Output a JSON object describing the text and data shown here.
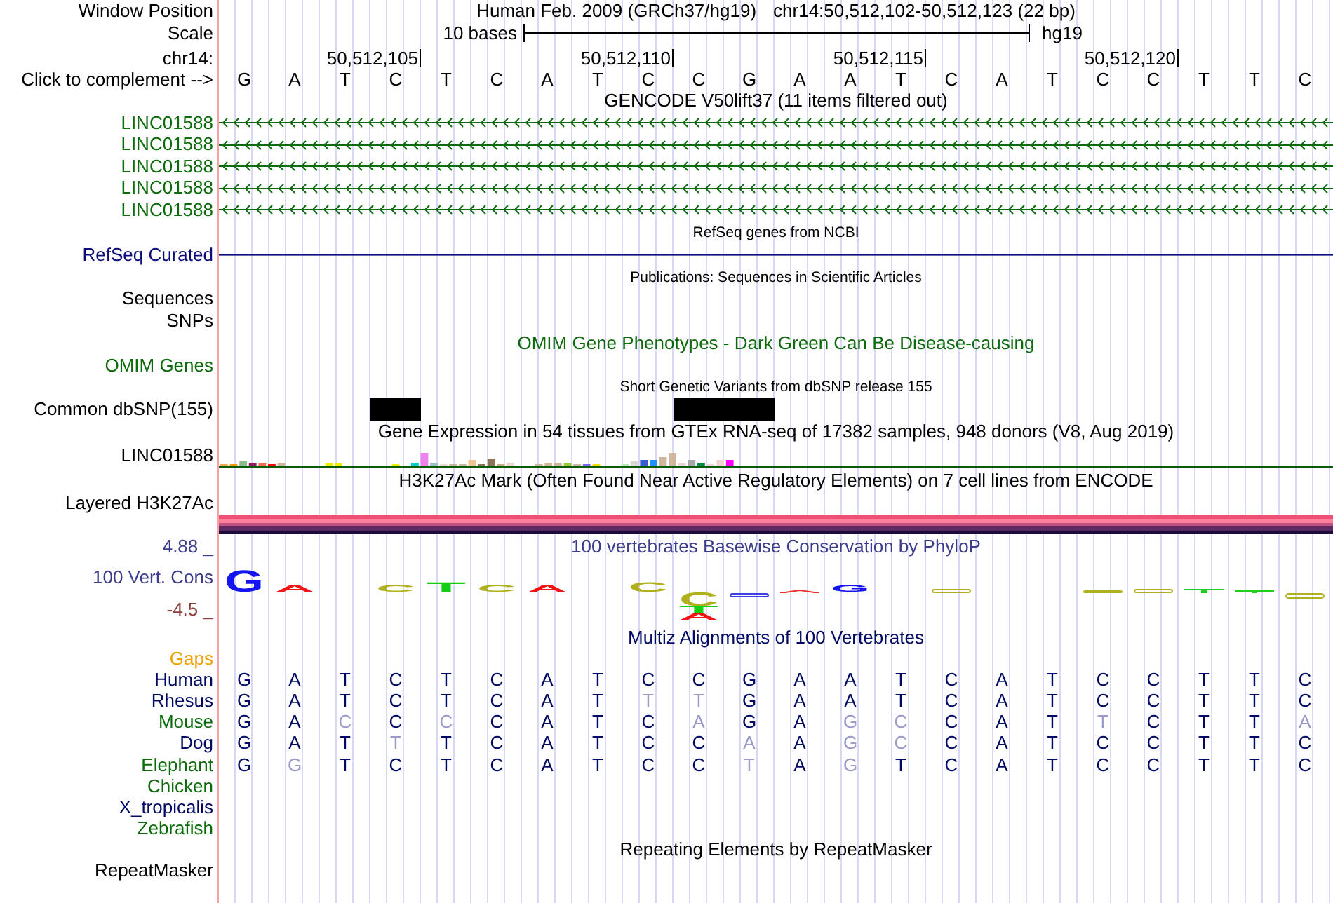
{
  "header": {
    "position": {
      "label": "Window Position",
      "assembly": "Human Feb. 2009 (GRCh37/hg19)",
      "range": "chr14:50,512,102-50,512,123 (22 bp)"
    },
    "scale": {
      "label": "Scale",
      "span": "10 bases",
      "genome": "hg19"
    },
    "ruler": {
      "label": "chr14:",
      "ticks": [
        "50,512,105",
        "50,512,110",
        "50,512,115",
        "50,512,120"
      ]
    },
    "sequence": {
      "label": "Click to complement -->",
      "bases": [
        "G",
        "A",
        "T",
        "C",
        "T",
        "C",
        "A",
        "T",
        "C",
        "C",
        "G",
        "A",
        "A",
        "T",
        "C",
        "A",
        "T",
        "C",
        "C",
        "T",
        "T",
        "C"
      ]
    }
  },
  "tracks": [
    {
      "kind": "genes",
      "title": "GENCODE V50lift37 (11 items filtered out)",
      "color": "#000000",
      "rows": [
        {
          "label": "LINC01588",
          "color": "#0c6c0c"
        },
        {
          "label": "LINC01588",
          "color": "#0c6c0c"
        },
        {
          "label": "LINC01588",
          "color": "#0c6c0c"
        },
        {
          "label": "LINC01588",
          "color": "#0c6c0c"
        },
        {
          "label": "LINC01588",
          "color": "#0c6c0c"
        }
      ]
    },
    {
      "kind": "refseq",
      "title": "RefSeq genes from NCBI",
      "color": "#000000",
      "rows": [
        {
          "label": "RefSeq Curated",
          "color": "#0c0c78"
        }
      ]
    },
    {
      "kind": "publications",
      "title": "Publications: Sequences in Scientific Articles",
      "color": "#000000",
      "rows": [
        {
          "label": "Sequences",
          "color": "#000000"
        },
        {
          "label": "SNPs",
          "color": "#000000"
        }
      ]
    },
    {
      "kind": "omim",
      "title": "OMIM Gene Phenotypes - Dark Green Can Be Disease-causing",
      "color": "#0c6c0c",
      "rows": [
        {
          "label": "OMIM Genes",
          "color": "#0c6c0c"
        }
      ]
    },
    {
      "kind": "dbsnp",
      "title": "Short Genetic Variants from dbSNP release 155",
      "color": "#000000",
      "rows": [
        {
          "label": "Common dbSNP(155)",
          "color": "#000000"
        }
      ]
    },
    {
      "kind": "gtex",
      "title": "Gene Expression in 54 tissues from GTEx RNA-seq of 17382 samples, 948 donors (V8, Aug 2019)",
      "color": "#000000",
      "rows": [
        {
          "label": "LINC01588",
          "color": "#000000"
        }
      ]
    },
    {
      "kind": "h3k27ac",
      "title": "H3K27Ac Mark (Often Found Near Active Regulatory Elements) on 7 cell lines from ENCODE",
      "color": "#000000",
      "rows": [
        {
          "label": "Layered H3K27Ac",
          "color": "#000000"
        }
      ]
    },
    {
      "kind": "phylop",
      "title": "100 vertebrates Basewise Conservation by PhyloP",
      "color": "#3c3c8c",
      "axis": [
        {
          "text": "4.88 _",
          "color": "#3c3c8c"
        },
        {
          "text": "-4.5 _",
          "color": "#8c3c3c"
        }
      ],
      "rows": [
        {
          "label": "100 Vert. Cons",
          "color": "#3c3c8c"
        }
      ],
      "logo": [
        {
          "above": [
            {
              "letter": "G",
              "color": "#1414f0"
            }
          ]
        },
        {
          "above": [
            {
              "letter": "A",
              "color": "#f01414"
            }
          ]
        },
        {
          "above": [
            {
              "letter": "C",
              "color": "#b0b01e"
            }
          ]
        },
        {
          "above": [
            {
              "letter": "T",
              "color": "#14d014"
            }
          ]
        },
        {
          "above": [
            {
              "letter": "C",
              "color": "#b0b01e"
            }
          ]
        },
        {
          "above": [
            {
              "letter": "A",
              "color": "#f01414"
            }
          ]
        },
        {
          "above": [
            {
              "letter": "C",
              "color": "#b0b01e"
            }
          ]
        },
        {
          "below": [
            {
              "letter": "C",
              "color": "#b0b01e"
            },
            {
              "letter": "T",
              "color": "#14d014"
            },
            {
              "letter": "A",
              "color": "#f01414"
            }
          ]
        },
        {
          "above": [
            {
              "letter": "G",
              "color": "#1414f0"
            }
          ]
        }
      ]
    },
    {
      "kind": "multiz",
      "title": "Multiz Alignments of 100 Vertebrates",
      "color": "#000a64",
      "rows": [
        {
          "label": "Gaps",
          "color": "#f0a000"
        },
        {
          "label": "Human",
          "color": "#000a64",
          "bases": [
            {
              "base": "G",
              "differs": false
            },
            {
              "base": "A",
              "differs": false
            },
            {
              "base": "T",
              "differs": false
            },
            {
              "base": "C",
              "differs": false
            },
            {
              "base": "T",
              "differs": false
            },
            {
              "base": "C",
              "differs": false
            },
            {
              "base": "A",
              "differs": false
            },
            {
              "base": "T",
              "differs": false
            },
            {
              "base": "C",
              "differs": false
            },
            {
              "base": "C",
              "differs": false
            },
            {
              "base": "G",
              "differs": false
            },
            {
              "base": "A",
              "differs": false
            },
            {
              "base": "A",
              "differs": false
            },
            {
              "base": "T",
              "differs": false
            },
            {
              "base": "C",
              "differs": false
            },
            {
              "base": "A",
              "differs": false
            },
            {
              "base": "T",
              "differs": false
            },
            {
              "base": "C",
              "differs": false
            },
            {
              "base": "C",
              "differs": false
            },
            {
              "base": "T",
              "differs": false
            },
            {
              "base": "T",
              "differs": false
            },
            {
              "base": "C",
              "differs": false
            }
          ]
        },
        {
          "label": "Rhesus",
          "color": "#000a64",
          "bases": [
            {
              "base": "G",
              "differs": false
            },
            {
              "base": "A",
              "differs": false
            },
            {
              "base": "T",
              "differs": false
            },
            {
              "base": "C",
              "differs": false
            },
            {
              "base": "T",
              "differs": false
            },
            {
              "base": "C",
              "differs": false
            },
            {
              "base": "A",
              "differs": false
            },
            {
              "base": "T",
              "differs": false
            },
            {
              "base": "T",
              "differs": true
            },
            {
              "base": "T",
              "differs": true
            },
            {
              "base": "G",
              "differs": false
            },
            {
              "base": "A",
              "differs": false
            },
            {
              "base": "A",
              "differs": false
            },
            {
              "base": "T",
              "differs": false
            },
            {
              "base": "C",
              "differs": false
            },
            {
              "base": "A",
              "differs": false
            },
            {
              "base": "T",
              "differs": false
            },
            {
              "base": "C",
              "differs": false
            },
            {
              "base": "C",
              "differs": false
            },
            {
              "base": "T",
              "differs": false
            },
            {
              "base": "T",
              "differs": false
            },
            {
              "base": "C",
              "differs": false
            }
          ]
        },
        {
          "label": "Mouse",
          "color": "#0c6c0c",
          "bases": [
            {
              "base": "G",
              "differs": false
            },
            {
              "base": "A",
              "differs": false
            },
            {
              "base": "C",
              "differs": true
            },
            {
              "base": "C",
              "differs": false
            },
            {
              "base": "C",
              "differs": true
            },
            {
              "base": "C",
              "differs": false
            },
            {
              "base": "A",
              "differs": false
            },
            {
              "base": "T",
              "differs": false
            },
            {
              "base": "C",
              "differs": false
            },
            {
              "base": "A",
              "differs": true
            },
            {
              "base": "G",
              "differs": false
            },
            {
              "base": "A",
              "differs": false
            },
            {
              "base": "G",
              "differs": true
            },
            {
              "base": "C",
              "differs": true
            },
            {
              "base": "C",
              "differs": false
            },
            {
              "base": "A",
              "differs": false
            },
            {
              "base": "T",
              "differs": false
            },
            {
              "base": "T",
              "differs": true
            },
            {
              "base": "C",
              "differs": false
            },
            {
              "base": "T",
              "differs": false
            },
            {
              "base": "T",
              "differs": false
            },
            {
              "base": "A",
              "differs": true
            }
          ]
        },
        {
          "label": "Dog",
          "color": "#000a64",
          "bases": [
            {
              "base": "G",
              "differs": false
            },
            {
              "base": "A",
              "differs": false
            },
            {
              "base": "T",
              "differs": false
            },
            {
              "base": "T",
              "differs": true
            },
            {
              "base": "T",
              "differs": false
            },
            {
              "base": "C",
              "differs": false
            },
            {
              "base": "A",
              "differs": false
            },
            {
              "base": "T",
              "differs": false
            },
            {
              "base": "C",
              "differs": false
            },
            {
              "base": "C",
              "differs": false
            },
            {
              "base": "A",
              "differs": true
            },
            {
              "base": "A",
              "differs": false
            },
            {
              "base": "G",
              "differs": true
            },
            {
              "base": "C",
              "differs": true
            },
            {
              "base": "C",
              "differs": false
            },
            {
              "base": "A",
              "differs": false
            },
            {
              "base": "T",
              "differs": false
            },
            {
              "base": "C",
              "differs": false
            },
            {
              "base": "C",
              "differs": false
            },
            {
              "base": "T",
              "differs": false
            },
            {
              "base": "T",
              "differs": false
            },
            {
              "base": "C",
              "differs": false
            }
          ]
        },
        {
          "label": "Elephant",
          "color": "#0c6c0c",
          "bases": [
            {
              "base": "G",
              "differs": false
            },
            {
              "base": "G",
              "differs": true
            },
            {
              "base": "T",
              "differs": false
            },
            {
              "base": "C",
              "differs": false
            },
            {
              "base": "T",
              "differs": false
            },
            {
              "base": "C",
              "differs": false
            },
            {
              "base": "A",
              "differs": false
            },
            {
              "base": "T",
              "differs": false
            },
            {
              "base": "C",
              "differs": false
            },
            {
              "base": "C",
              "differs": false
            },
            {
              "base": "T",
              "differs": true
            },
            {
              "base": "A",
              "differs": false
            },
            {
              "base": "G",
              "differs": true
            },
            {
              "base": "T",
              "differs": false
            },
            {
              "base": "C",
              "differs": false
            },
            {
              "base": "A",
              "differs": false
            },
            {
              "base": "T",
              "differs": false
            },
            {
              "base": "C",
              "differs": false
            },
            {
              "base": "C",
              "differs": false
            },
            {
              "base": "T",
              "differs": false
            },
            {
              "base": "T",
              "differs": false
            },
            {
              "base": "C",
              "differs": false
            }
          ]
        },
        {
          "label": "Chicken",
          "color": "#0c6c0c"
        },
        {
          "label": "X_tropicalis",
          "color": "#000a64"
        },
        {
          "label": "Zebrafish",
          "color": "#0c6c0c"
        }
      ]
    },
    {
      "kind": "repeatmasker",
      "title": "Repeating Elements by RepeatMasker",
      "color": "#000000",
      "rows": [
        {
          "label": "RepeatMasker",
          "color": "#000000"
        }
      ]
    }
  ]
}
